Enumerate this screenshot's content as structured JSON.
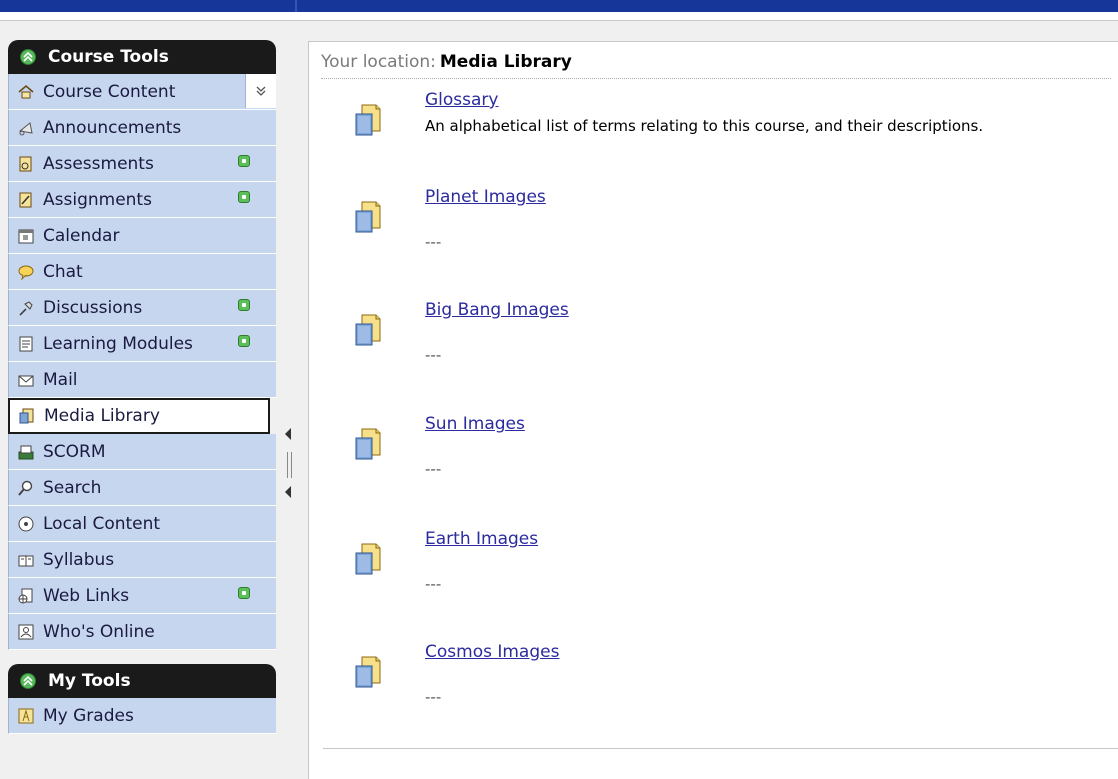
{
  "sidebar": {
    "course_tools": {
      "title": "Course Tools",
      "items": [
        {
          "label": "Course Content",
          "icon": "home-icon",
          "has_dropdown": true,
          "dropdown_glyph": "»"
        },
        {
          "label": "Announcements",
          "icon": "announcement-icon"
        },
        {
          "label": "Assessments",
          "icon": "assessment-icon",
          "new": true
        },
        {
          "label": "Assignments",
          "icon": "assignment-icon",
          "new": true
        },
        {
          "label": "Calendar",
          "icon": "calendar-icon"
        },
        {
          "label": "Chat",
          "icon": "chat-icon"
        },
        {
          "label": "Discussions",
          "icon": "discussion-pin-icon",
          "new": true
        },
        {
          "label": "Learning Modules",
          "icon": "learning-module-icon",
          "new": true
        },
        {
          "label": "Mail",
          "icon": "mail-icon"
        },
        {
          "label": "Media Library",
          "icon": "media-library-icon",
          "selected": true
        },
        {
          "label": "SCORM",
          "icon": "scorm-icon"
        },
        {
          "label": "Search",
          "icon": "search-icon"
        },
        {
          "label": "Local Content",
          "icon": "local-content-icon"
        },
        {
          "label": "Syllabus",
          "icon": "syllabus-icon"
        },
        {
          "label": "Web Links",
          "icon": "web-links-icon",
          "new": true
        },
        {
          "label": "Who's Online",
          "icon": "whos-online-icon"
        }
      ]
    },
    "my_tools": {
      "title": "My Tools",
      "items": [
        {
          "label": "My Grades",
          "icon": "grades-icon"
        }
      ]
    }
  },
  "main": {
    "location_label": "Your location:",
    "location_value": "Media Library",
    "items": [
      {
        "title": "Glossary",
        "description": "An alphabetical list of terms relating to this course, and their descriptions.",
        "icon": "document-icon"
      },
      {
        "title": "Planet Images",
        "description": "---",
        "icon": "document-icon"
      },
      {
        "title": "Big Bang Images",
        "description": "---",
        "icon": "document-icon"
      },
      {
        "title": "Sun Images",
        "description": "---",
        "icon": "document-icon"
      },
      {
        "title": "Earth Images",
        "description": "---",
        "icon": "document-icon"
      },
      {
        "title": "Cosmos Images",
        "description": "---",
        "icon": "document-icon"
      }
    ]
  },
  "colors": {
    "top_bar": "#17369a",
    "menu_bg": "#c7d6ef",
    "header_bg": "#1a1a1a",
    "link": "#2b2b9e",
    "new_badge": "#5cbf5c"
  }
}
